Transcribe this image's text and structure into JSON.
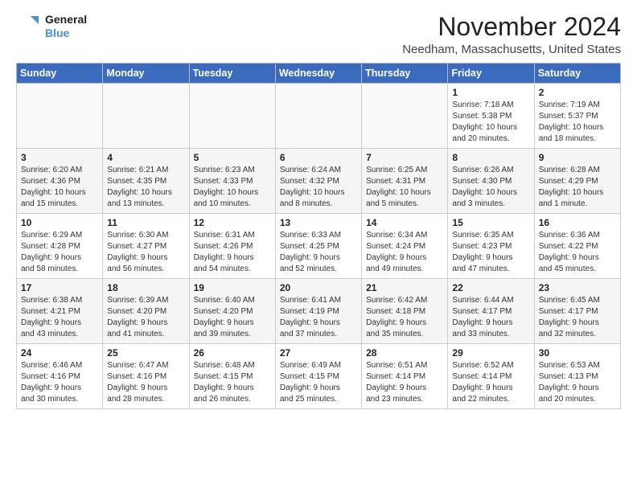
{
  "logo": {
    "line1": "General",
    "line2": "Blue"
  },
  "title": "November 2024",
  "location": "Needham, Massachusetts, United States",
  "weekdays": [
    "Sunday",
    "Monday",
    "Tuesday",
    "Wednesday",
    "Thursday",
    "Friday",
    "Saturday"
  ],
  "weeks": [
    [
      {
        "day": "",
        "info": ""
      },
      {
        "day": "",
        "info": ""
      },
      {
        "day": "",
        "info": ""
      },
      {
        "day": "",
        "info": ""
      },
      {
        "day": "",
        "info": ""
      },
      {
        "day": "1",
        "info": "Sunrise: 7:18 AM\nSunset: 5:38 PM\nDaylight: 10 hours\nand 20 minutes."
      },
      {
        "day": "2",
        "info": "Sunrise: 7:19 AM\nSunset: 5:37 PM\nDaylight: 10 hours\nand 18 minutes."
      }
    ],
    [
      {
        "day": "3",
        "info": "Sunrise: 6:20 AM\nSunset: 4:36 PM\nDaylight: 10 hours\nand 15 minutes."
      },
      {
        "day": "4",
        "info": "Sunrise: 6:21 AM\nSunset: 4:35 PM\nDaylight: 10 hours\nand 13 minutes."
      },
      {
        "day": "5",
        "info": "Sunrise: 6:23 AM\nSunset: 4:33 PM\nDaylight: 10 hours\nand 10 minutes."
      },
      {
        "day": "6",
        "info": "Sunrise: 6:24 AM\nSunset: 4:32 PM\nDaylight: 10 hours\nand 8 minutes."
      },
      {
        "day": "7",
        "info": "Sunrise: 6:25 AM\nSunset: 4:31 PM\nDaylight: 10 hours\nand 5 minutes."
      },
      {
        "day": "8",
        "info": "Sunrise: 6:26 AM\nSunset: 4:30 PM\nDaylight: 10 hours\nand 3 minutes."
      },
      {
        "day": "9",
        "info": "Sunrise: 6:28 AM\nSunset: 4:29 PM\nDaylight: 10 hours\nand 1 minute."
      }
    ],
    [
      {
        "day": "10",
        "info": "Sunrise: 6:29 AM\nSunset: 4:28 PM\nDaylight: 9 hours\nand 58 minutes."
      },
      {
        "day": "11",
        "info": "Sunrise: 6:30 AM\nSunset: 4:27 PM\nDaylight: 9 hours\nand 56 minutes."
      },
      {
        "day": "12",
        "info": "Sunrise: 6:31 AM\nSunset: 4:26 PM\nDaylight: 9 hours\nand 54 minutes."
      },
      {
        "day": "13",
        "info": "Sunrise: 6:33 AM\nSunset: 4:25 PM\nDaylight: 9 hours\nand 52 minutes."
      },
      {
        "day": "14",
        "info": "Sunrise: 6:34 AM\nSunset: 4:24 PM\nDaylight: 9 hours\nand 49 minutes."
      },
      {
        "day": "15",
        "info": "Sunrise: 6:35 AM\nSunset: 4:23 PM\nDaylight: 9 hours\nand 47 minutes."
      },
      {
        "day": "16",
        "info": "Sunrise: 6:36 AM\nSunset: 4:22 PM\nDaylight: 9 hours\nand 45 minutes."
      }
    ],
    [
      {
        "day": "17",
        "info": "Sunrise: 6:38 AM\nSunset: 4:21 PM\nDaylight: 9 hours\nand 43 minutes."
      },
      {
        "day": "18",
        "info": "Sunrise: 6:39 AM\nSunset: 4:20 PM\nDaylight: 9 hours\nand 41 minutes."
      },
      {
        "day": "19",
        "info": "Sunrise: 6:40 AM\nSunset: 4:20 PM\nDaylight: 9 hours\nand 39 minutes."
      },
      {
        "day": "20",
        "info": "Sunrise: 6:41 AM\nSunset: 4:19 PM\nDaylight: 9 hours\nand 37 minutes."
      },
      {
        "day": "21",
        "info": "Sunrise: 6:42 AM\nSunset: 4:18 PM\nDaylight: 9 hours\nand 35 minutes."
      },
      {
        "day": "22",
        "info": "Sunrise: 6:44 AM\nSunset: 4:17 PM\nDaylight: 9 hours\nand 33 minutes."
      },
      {
        "day": "23",
        "info": "Sunrise: 6:45 AM\nSunset: 4:17 PM\nDaylight: 9 hours\nand 32 minutes."
      }
    ],
    [
      {
        "day": "24",
        "info": "Sunrise: 6:46 AM\nSunset: 4:16 PM\nDaylight: 9 hours\nand 30 minutes."
      },
      {
        "day": "25",
        "info": "Sunrise: 6:47 AM\nSunset: 4:16 PM\nDaylight: 9 hours\nand 28 minutes."
      },
      {
        "day": "26",
        "info": "Sunrise: 6:48 AM\nSunset: 4:15 PM\nDaylight: 9 hours\nand 26 minutes."
      },
      {
        "day": "27",
        "info": "Sunrise: 6:49 AM\nSunset: 4:15 PM\nDaylight: 9 hours\nand 25 minutes."
      },
      {
        "day": "28",
        "info": "Sunrise: 6:51 AM\nSunset: 4:14 PM\nDaylight: 9 hours\nand 23 minutes."
      },
      {
        "day": "29",
        "info": "Sunrise: 6:52 AM\nSunset: 4:14 PM\nDaylight: 9 hours\nand 22 minutes."
      },
      {
        "day": "30",
        "info": "Sunrise: 6:53 AM\nSunset: 4:13 PM\nDaylight: 9 hours\nand 20 minutes."
      }
    ]
  ]
}
